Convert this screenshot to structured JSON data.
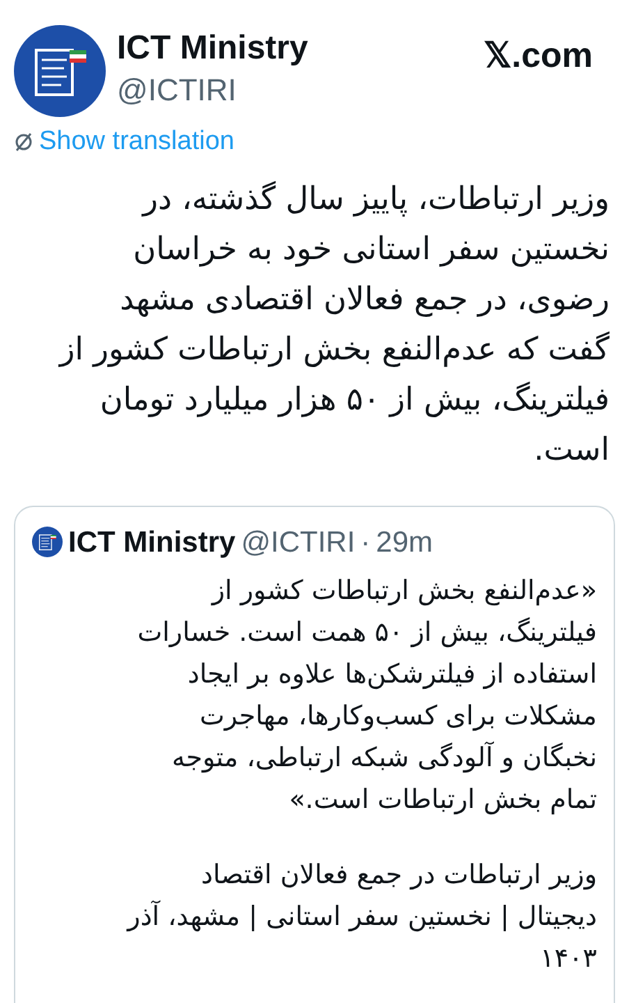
{
  "author": {
    "name": "ICT Ministry",
    "handle": "@ICTIRI"
  },
  "site": "𝕏.com",
  "translate_link": "Show translation",
  "post_text": "وزیر ارتباطات، پاییز سال گذشته، در\nنخستین سفر استانی خود به خراسان\nرضوی، در جمع فعالان اقتصادی مشهد\nگفت که عدم‌النفع بخش ارتباطات کشور از\nفیلترینگ، بیش از ۵۰ هزار میلیارد تومان\nاست.",
  "quoted_post": {
    "name": "ICT Ministry",
    "handle": "@ICTIRI",
    "separator": "·",
    "time": "29m",
    "paragraphs": [
      "«عدم‌النفع بخش ارتباطات کشور از\nفیلترینگ، بیش از ۵۰ همت است. خسارات\nاستفاده از فیلترشکن‌ها علاوه بر ایجاد\nمشکلات برای کسب‌وکارها، مهاجرت\nنخبگان و آلودگی شبکه ارتباطی، متوجه\nتمام بخش ارتباطات است.»",
      "وزیر ارتباطات در جمع فعالان اقتصاد\nدیجیتال | نخستین سفر استانی | مشهد، آذر\n۱۴۰۳"
    ]
  }
}
